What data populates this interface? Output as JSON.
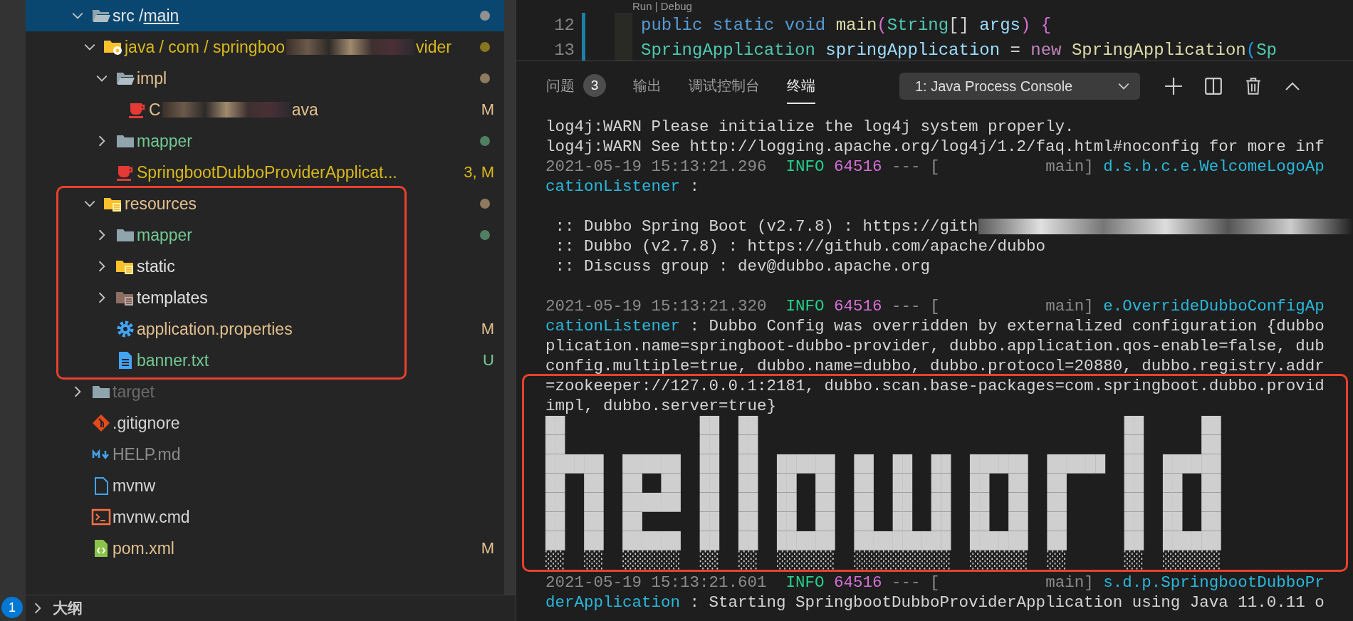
{
  "activity_bar": {
    "badge": "1"
  },
  "explorer": {
    "tree": [
      {
        "kind": "open-folder",
        "segments": [
          {
            "text": "src /"
          },
          {
            "text": "main",
            "underline": true
          }
        ],
        "color": "#e8e8e8",
        "dot": true,
        "selected": true,
        "expanded": true,
        "children": [
          {
            "kind": "source-folder",
            "segments": [
              {
                "text": "java / com / springboo",
                "blur_after": true
              },
              {
                "text": "vider"
              }
            ],
            "color": "#d9b81a",
            "dot": true,
            "selected": false,
            "expanded": true,
            "children": [
              {
                "kind": "open-folder",
                "segments": [
                  {
                    "text": "impl"
                  }
                ],
                "color": "#e2c08d",
                "dot": true,
                "selected": false,
                "expanded": true,
                "children": [
                  {
                    "kind": "java-file",
                    "segments": [
                      {
                        "text": "C",
                        "blur_after": true
                      },
                      {
                        "text": "ava"
                      }
                    ],
                    "color": "#e2c08d",
                    "badge": "M",
                    "selected": false
                  }
                ]
              },
              {
                "kind": "folder",
                "segments": [
                  {
                    "text": "mapper"
                  }
                ],
                "color": "#73c991",
                "dot": true,
                "selected": false,
                "expanded": false
              },
              {
                "kind": "java-file",
                "segments": [
                  {
                    "text": "SpringbootDubboProviderApplicat..."
                  }
                ],
                "color": "#d9b81a",
                "badge": "3, M",
                "selected": false
              }
            ]
          },
          {
            "kind": "resource-folder",
            "segments": [
              {
                "text": "resources"
              }
            ],
            "color": "#e2c08d",
            "dot": true,
            "selected": false,
            "expanded": true,
            "children": [
              {
                "kind": "folder",
                "segments": [
                  {
                    "text": "mapper"
                  }
                ],
                "color": "#73c991",
                "dot": true,
                "selected": false,
                "expanded": false
              },
              {
                "kind": "resource-folder",
                "segments": [
                  {
                    "text": "static"
                  }
                ],
                "color": "#e0e0e0",
                "selected": false,
                "expanded": false
              },
              {
                "kind": "template-folder",
                "segments": [
                  {
                    "text": "templates"
                  }
                ],
                "color": "#e0e0e0",
                "selected": false,
                "expanded": false
              },
              {
                "kind": "settings-file",
                "segments": [
                  {
                    "text": "application.properties"
                  }
                ],
                "color": "#e2c08d",
                "badge": "M",
                "selected": false
              },
              {
                "kind": "text-file",
                "segments": [
                  {
                    "text": "banner.txt"
                  }
                ],
                "color": "#73c991",
                "badge": "U",
                "selected": false
              }
            ]
          }
        ]
      },
      {
        "kind": "folder",
        "segments": [
          {
            "text": "target"
          }
        ],
        "color": "#6b6b6b",
        "selected": false,
        "expanded": false
      },
      {
        "kind": "git-file",
        "segments": [
          {
            "text": ".gitignore"
          }
        ],
        "color": "#d4d4d4",
        "selected": false
      },
      {
        "kind": "markdown-file",
        "segments": [
          {
            "text": "HELP.md"
          }
        ],
        "color": "#8c8c8c",
        "selected": false
      },
      {
        "kind": "plain-file",
        "segments": [
          {
            "text": "mvnw"
          }
        ],
        "color": "#d4d4d4",
        "selected": false
      },
      {
        "kind": "script-file",
        "segments": [
          {
            "text": "mvnw.cmd"
          }
        ],
        "color": "#d4d4d4",
        "selected": false
      },
      {
        "kind": "xml-file",
        "segments": [
          {
            "text": "pom.xml"
          }
        ],
        "color": "#e2c08d",
        "badge": "M",
        "selected": false
      }
    ],
    "outline": {
      "label": "大纲",
      "expanded": false
    }
  },
  "editor": {
    "codelens": "Run | Debug",
    "lines": [
      {
        "number": "12",
        "tokens": [
          {
            "text": "public ",
            "color": "#569cd6"
          },
          {
            "text": "static ",
            "color": "#569cd6"
          },
          {
            "text": "void ",
            "color": "#569cd6"
          },
          {
            "text": "main",
            "color": "#dcdcaa"
          },
          {
            "text": "(",
            "color": "#da70d6"
          },
          {
            "text": "String",
            "color": "#4ec9b0"
          },
          {
            "text": "[] ",
            "color": "#d4d4d4"
          },
          {
            "text": "args",
            "color": "#9cdcfe"
          },
          {
            "text": ") ",
            "color": "#da70d6"
          },
          {
            "text": "{",
            "color": "#da70d6"
          }
        ]
      },
      {
        "number": "13",
        "tokens": [
          {
            "text": "SpringApplication ",
            "color": "#4ec9b0"
          },
          {
            "text": "springApplication ",
            "color": "#9cdcfe"
          },
          {
            "text": "= ",
            "color": "#d4d4d4"
          },
          {
            "text": "new ",
            "color": "#c586c0"
          },
          {
            "text": "SpringApplication",
            "color": "#dcdcaa"
          },
          {
            "text": "(",
            "color": "#179fff"
          },
          {
            "text": "Sp",
            "color": "#4ec9b0"
          }
        ]
      }
    ]
  },
  "panel": {
    "tabs": [
      {
        "label": "问题",
        "badge": "3",
        "selected": false
      },
      {
        "label": "输出",
        "selected": false
      },
      {
        "label": "调试控制台",
        "selected": false
      },
      {
        "label": "终端",
        "selected": true
      }
    ],
    "terminal_select": "1: Java Process Console",
    "lines": [
      {
        "kind": "text",
        "spans": [
          {
            "kind": "plain",
            "text": "log4j:WARN Please initialize the log4j system properly."
          }
        ]
      },
      {
        "kind": "text",
        "spans": [
          {
            "kind": "plain",
            "text": "log4j:WARN See http://logging.apache.org/log4j/1.2/faq.html#noconfig for more inf"
          }
        ]
      },
      {
        "kind": "text",
        "spans": [
          {
            "kind": "time",
            "text": "2021-05-19 15:13:21.296  "
          },
          {
            "kind": "level",
            "text": "INFO"
          },
          {
            "kind": "pid",
            "text": " 64516"
          },
          {
            "kind": "time",
            "text": " --- [           main]"
          },
          {
            "kind": "logger",
            "text": " d.s.b.c.e.WelcomeLogoAp"
          }
        ]
      },
      {
        "kind": "text",
        "spans": [
          {
            "kind": "logger",
            "text": "cationListener"
          },
          {
            "kind": "plain",
            "text": " :"
          }
        ]
      },
      {
        "kind": "blank"
      },
      {
        "kind": "text",
        "spans": [
          {
            "kind": "plain",
            "text": " :: Dubbo Spring Boot (v2.7.8) : https://gith"
          },
          {
            "kind": "blur"
          }
        ]
      },
      {
        "kind": "text",
        "spans": [
          {
            "kind": "plain",
            "text": " :: Dubbo (v2.7.8) : https://github.com/apache/dubbo"
          }
        ]
      },
      {
        "kind": "text",
        "spans": [
          {
            "kind": "plain",
            "text": " :: Discuss group : dev@dubbo.apache.org"
          }
        ]
      },
      {
        "kind": "blank"
      },
      {
        "kind": "text",
        "spans": [
          {
            "kind": "time",
            "text": "2021-05-19 15:13:21.320  "
          },
          {
            "kind": "level",
            "text": "INFO"
          },
          {
            "kind": "pid",
            "text": " 64516"
          },
          {
            "kind": "time",
            "text": " --- [           main]"
          },
          {
            "kind": "logger",
            "text": " e.OverrideDubboConfigAp"
          }
        ]
      },
      {
        "kind": "text",
        "spans": [
          {
            "kind": "logger",
            "text": "cationListener"
          },
          {
            "kind": "plain",
            "text": " : Dubbo Config was overridden by externalized configuration {dubbo"
          }
        ]
      },
      {
        "kind": "text",
        "spans": [
          {
            "kind": "plain",
            "text": "plication.name=springboot-dubbo-provider, dubbo.application.qos-enable=false, dub"
          }
        ]
      },
      {
        "kind": "text",
        "spans": [
          {
            "kind": "plain",
            "text": "config.multiple=true, dubbo.name=dubbo, dubbo.protocol=20880, dubbo.registry.addr"
          }
        ]
      },
      {
        "kind": "text",
        "spans": [
          {
            "kind": "plain",
            "text": "=zookeeper://127.0.0.1:2181, dubbo.scan.base-packages=com.springboot.dubbo.provid"
          }
        ]
      },
      {
        "kind": "text",
        "spans": [
          {
            "kind": "plain",
            "text": "impl, dubbo.server=true}"
          }
        ]
      },
      {
        "kind": "art",
        "text": "██              ██  ██                                      ██      ██"
      },
      {
        "kind": "art",
        "text": "██              ██  ██                                      ██      ██"
      },
      {
        "kind": "art",
        "text": "██████  ██████  ██  ██  ██████  ██  ██  ██  ██████  ██████  ██  ██████"
      },
      {
        "kind": "art",
        "text": "██  ██  ██  ██  ██  ██  ██  ██  ██  ██  ██  ██  ██  ██      ██  ██  ██"
      },
      {
        "kind": "art",
        "text": "██  ██  ██████  ██  ██  ██  ██  ██  ██  ██  ██  ██  ██      ██  ██  ██"
      },
      {
        "kind": "art",
        "text": "██  ██  ██      ██  ██  ██  ██  ██  ██  ██  ██  ██  ██      ██  ██  ██"
      },
      {
        "kind": "art",
        "text": "██  ██  ██████  ██  ██  ██████  ██████████  ██████  ██      ██  ██████"
      },
      {
        "kind": "art",
        "text": "░░  ░░  ░░░░░░  ░░  ░░  ░░░░░░  ░░░░░░░░░░  ░░░░░░  ░░      ░░  ░░░░░░"
      },
      {
        "kind": "text",
        "spans": [
          {
            "kind": "time",
            "text": "2021-05-19 15:13:21.601  "
          },
          {
            "kind": "level",
            "text": "INFO"
          },
          {
            "kind": "pid",
            "text": " 64516"
          },
          {
            "kind": "time",
            "text": " --- [           main]"
          },
          {
            "kind": "logger",
            "text": " s.d.p.SpringbootDubboPr"
          }
        ]
      },
      {
        "kind": "text",
        "spans": [
          {
            "kind": "logger",
            "text": "derApplication"
          },
          {
            "kind": "plain",
            "text": " : Starting SpringbootDubboProviderApplication using Java 11.0.11 o"
          }
        ]
      }
    ]
  },
  "highlight_frames": {
    "explorer": true,
    "terminal": true
  }
}
